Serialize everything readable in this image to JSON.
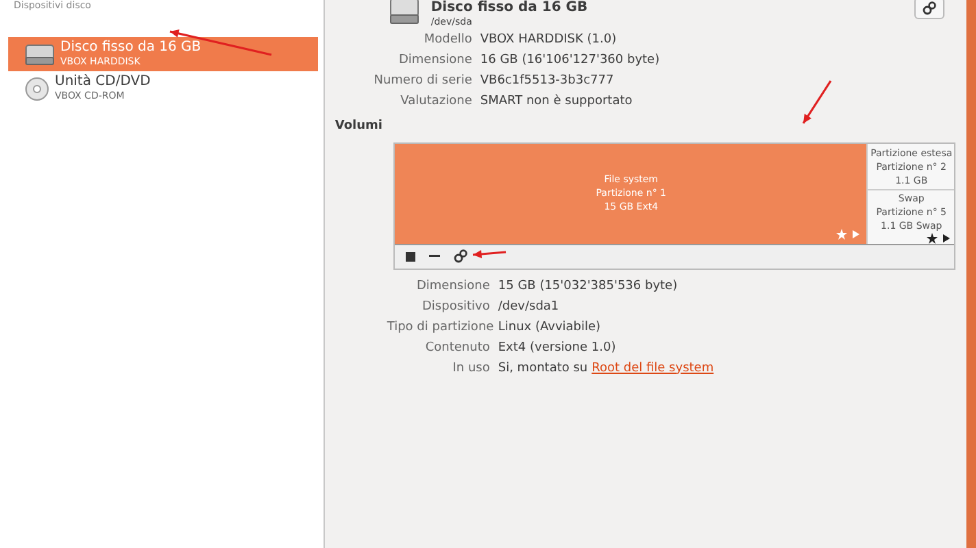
{
  "sidebar": {
    "header": "Dispositivi disco",
    "items": [
      {
        "kind": "hdd",
        "name": "Disco fisso da 16 GB",
        "subtitle": "VBOX HARDDISK",
        "selected": true
      },
      {
        "kind": "cdrom",
        "name": "Unità CD/DVD",
        "subtitle": "VBOX CD-ROM",
        "selected": false
      }
    ]
  },
  "disk": {
    "title": "Disco fisso da 16 GB",
    "device": "/dev/sda",
    "properties": [
      {
        "label": "Modello",
        "value": "VBOX HARDDISK (1.0)"
      },
      {
        "label": "Dimensione",
        "value": "16 GB (16'106'127'360 byte)"
      },
      {
        "label": "Numero di serie",
        "value": "VB6c1f5513-3b3c777"
      },
      {
        "label": "Valutazione",
        "value": "SMART non è supportato"
      }
    ]
  },
  "volumes": {
    "heading": "Volumi",
    "partitions": [
      {
        "kind": "primary",
        "lines": [
          "File system",
          "Partizione n° 1",
          "15 GB Ext4"
        ],
        "selected": true
      },
      {
        "kind": "extended",
        "lines": [
          "Partizione estesa",
          "Partizione n° 2",
          "1.1 GB"
        ],
        "selected": false,
        "children": [
          {
            "kind": "logical",
            "lines": [
              "Swap",
              "Partizione n° 5",
              "1.1 GB Swap"
            ],
            "selected": false
          }
        ]
      }
    ],
    "toolbar": [
      {
        "kind": "stop"
      },
      {
        "kind": "remove"
      },
      {
        "kind": "settings"
      }
    ]
  },
  "partition_properties": [
    {
      "label": "Dimensione",
      "value": "15 GB (15'032'385'536 byte)"
    },
    {
      "label": "Dispositivo",
      "value": "/dev/sda1"
    },
    {
      "label": "Tipo di partizione",
      "value": "Linux (Avviabile)"
    },
    {
      "label": "Contenuto",
      "value": "Ext4 (versione 1.0)"
    },
    {
      "label": "In uso",
      "value": "Si, montato su",
      "link": "Root del file system"
    }
  ]
}
